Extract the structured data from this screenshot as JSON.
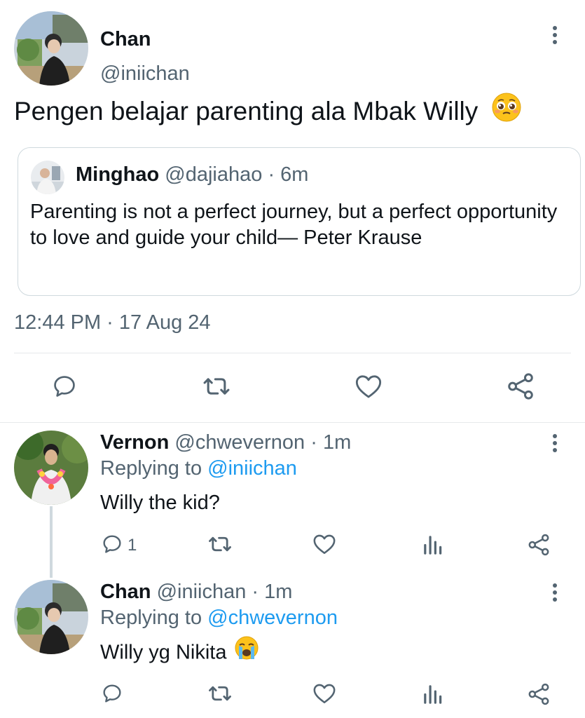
{
  "main_tweet": {
    "author_name": "Chan",
    "author_handle": "@iniichan",
    "text": "Pengen belajar parenting ala Mbak Willy",
    "text_emoji": "pleading-face-emoji",
    "timestamp": "12:44 PM · 17 Aug 24",
    "quote": {
      "author_name": "Minghao",
      "author_handle": "@dajiahao",
      "time_ago": "· 6m",
      "text": "Parenting is not a perfect journey, but a perfect opportunity to love and guide your child— Peter Krause"
    },
    "actions": [
      "reply-icon",
      "retweet-icon",
      "like-icon",
      "share-icon"
    ]
  },
  "replies": [
    {
      "author_name": "Vernon",
      "author_handle": "@chwevernon",
      "time_ago": "· 1m",
      "replying_prefix": "Replying to",
      "replying_to": "@iniichan",
      "text": "Willy the kid?",
      "reply_count": "1",
      "actions": [
        "reply-icon",
        "retweet-icon",
        "like-icon",
        "analytics-icon",
        "share-icon"
      ]
    },
    {
      "author_name": "Chan",
      "author_handle": "@iniichan",
      "time_ago": "· 1m",
      "replying_prefix": "Replying to",
      "replying_to": "@chwevernon",
      "text": "Willy yg Nikita",
      "text_emoji": "loudly-crying-face-emoji",
      "actions": [
        "reply-icon",
        "retweet-icon",
        "like-icon",
        "analytics-icon",
        "share-icon"
      ]
    }
  ],
  "colors": {
    "text_primary": "#0f1419",
    "text_secondary": "#536471",
    "link": "#1d9bf0",
    "border": "#cfd9de"
  }
}
